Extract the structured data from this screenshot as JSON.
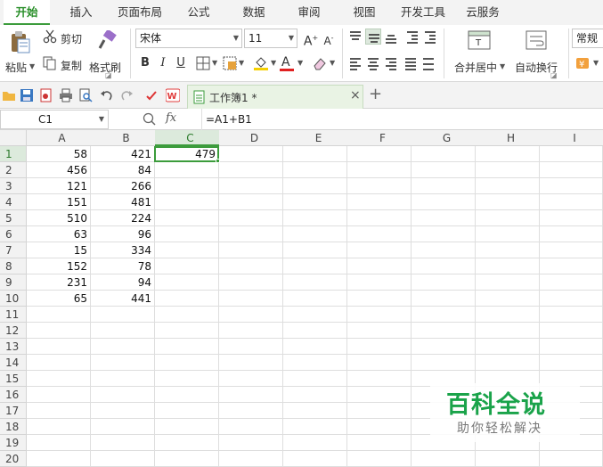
{
  "menu_tabs": [
    "开始",
    "插入",
    "页面布局",
    "公式",
    "数据",
    "审阅",
    "视图",
    "开发工具",
    "云服务"
  ],
  "ribbon": {
    "paste_label": "粘贴",
    "cut_label": "剪切",
    "copy_label": "复制",
    "format_painter_label": "格式刷",
    "font_name": "宋体",
    "font_size": "11",
    "bold_glyph": "B",
    "italic_glyph": "I",
    "underline_glyph": "U",
    "font_color_glyph": "A",
    "merge_center_label": "合并居中",
    "wrap_text_label": "自动换行",
    "number_format": "常规"
  },
  "document_tab": {
    "title": "工作簿1 *",
    "close_glyph": "×",
    "new_tab_glyph": "+"
  },
  "formula_bar": {
    "name_box": "C1",
    "fx_label": "fx",
    "formula": "=A1+B1"
  },
  "grid": {
    "columns": [
      "A",
      "B",
      "C",
      "D",
      "E",
      "F",
      "G",
      "H",
      "I"
    ],
    "rows": [
      "1",
      "2",
      "3",
      "4",
      "5",
      "6",
      "7",
      "8",
      "9",
      "10",
      "11",
      "12",
      "13",
      "14",
      "15",
      "16",
      "17",
      "18",
      "19",
      "20"
    ],
    "selected_cell": "C1",
    "col_a_values": [
      "58",
      "456",
      "121",
      "151",
      "510",
      "63",
      "15",
      "152",
      "231",
      "65"
    ],
    "col_b_values": [
      "421",
      "84",
      "266",
      "481",
      "224",
      "96",
      "334",
      "78",
      "94",
      "441"
    ],
    "c1_value": "479"
  },
  "watermark": {
    "title": "百科全说",
    "subtitle": "助你轻松解决"
  },
  "colors": {
    "accent_green": "#3c9c3c",
    "tab_active_text": "#2a8f2a",
    "watermark_green": "#1aa34a",
    "font_color_red": "#e02020"
  }
}
